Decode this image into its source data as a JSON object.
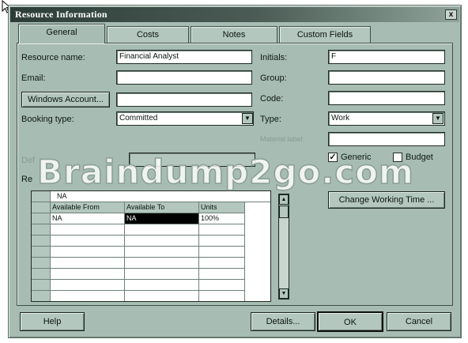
{
  "window": {
    "title": "Resource Information",
    "close_glyph": "x"
  },
  "tabs": [
    {
      "label": "General",
      "active": true
    },
    {
      "label": "Costs",
      "active": false
    },
    {
      "label": "Notes",
      "active": false
    },
    {
      "label": "Custom Fields",
      "active": false
    }
  ],
  "form": {
    "resource_name_label": "Resource name:",
    "resource_name_value": "Financial Analyst",
    "email_label": "Email:",
    "email_value": "",
    "windows_account_button": "Windows Account...",
    "windows_account_value": "",
    "booking_type_label": "Booking type:",
    "booking_type_value": "Committed",
    "initials_label": "Initials:",
    "initials_value": "F",
    "group_label": "Group:",
    "group_value": "",
    "code_label": "Code:",
    "code_value": "",
    "type_label": "Type:",
    "type_value": "Work",
    "material_label": "Material label:",
    "material_value": "",
    "generic_label": "Generic",
    "generic_checked": true,
    "budget_label": "Budget",
    "budget_checked": false,
    "default_label": "Def",
    "resource_availability_label": "Re",
    "change_working_time_button": "Change Working Time ..."
  },
  "availability_grid": {
    "edit_bar_value": "NA",
    "columns": [
      "Available From",
      "Available To",
      "Units"
    ],
    "rows": [
      [
        "NA",
        "NA",
        "100%"
      ],
      [
        "",
        "",
        ""
      ],
      [
        "",
        "",
        ""
      ],
      [
        "",
        "",
        ""
      ],
      [
        "",
        "",
        ""
      ],
      [
        "",
        "",
        ""
      ],
      [
        "",
        "",
        ""
      ],
      [
        "",
        "",
        ""
      ]
    ]
  },
  "footer": {
    "help_button": "Help",
    "details_button": "Details...",
    "ok_button": "OK",
    "cancel_button": "Cancel"
  },
  "watermark": "Braindump2go.com",
  "colors": {
    "dialog_bg": "#a7bcb2",
    "titlebar": "#2c3d37",
    "field_bg": "#ffffff",
    "selected_cell": "#000000"
  }
}
